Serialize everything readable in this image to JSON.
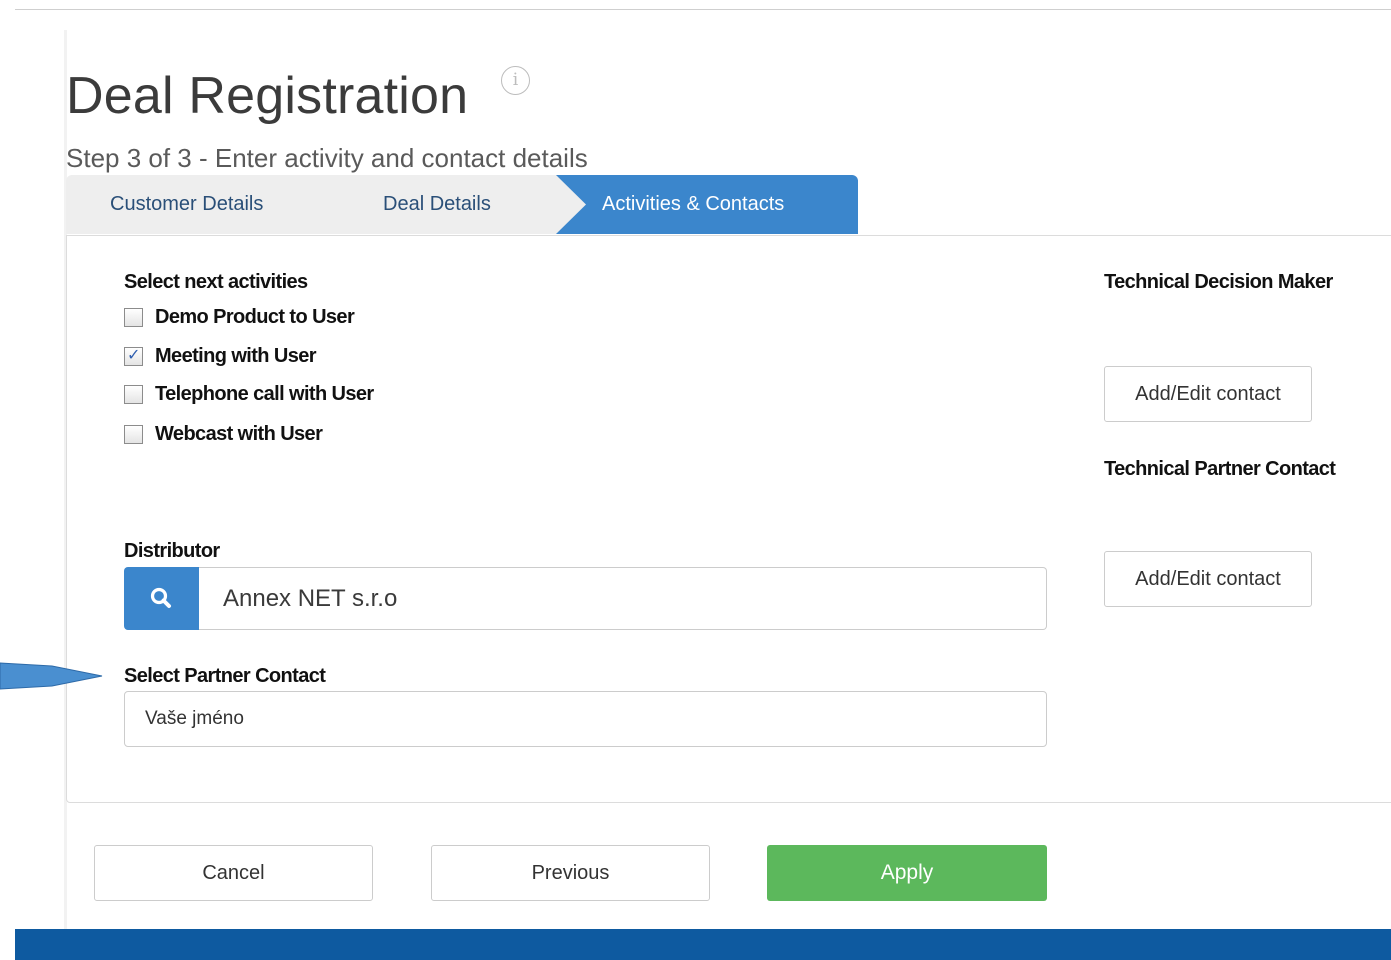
{
  "page": {
    "title": "Deal Registration",
    "info_icon_glyph": "i",
    "step_text": "Step 3 of 3 - Enter activity and contact details"
  },
  "wizard": {
    "tabs": [
      {
        "label": "Customer Details",
        "state": "done"
      },
      {
        "label": "Deal Details",
        "state": "done"
      },
      {
        "label": "Activities & Contacts",
        "state": "active"
      }
    ],
    "active_color": "#3b86cc",
    "inactive_color": "#eeeeee"
  },
  "activities": {
    "heading": "Select next activities",
    "items": [
      {
        "label": "Demo Product to User",
        "checked": false
      },
      {
        "label": "Meeting with User",
        "checked": true
      },
      {
        "label": "Telephone call with User",
        "checked": false
      },
      {
        "label": "Webcast with User",
        "checked": false
      }
    ]
  },
  "distributor": {
    "label": "Distributor",
    "value": "Annex NET s.r.o",
    "search_icon": "search-icon"
  },
  "partner_contact": {
    "label": "Select Partner Contact",
    "placeholder": "Vaše jméno"
  },
  "technical_decision_maker": {
    "label": "Technical Decision Maker",
    "button": "Add/Edit contact"
  },
  "technical_partner_contact": {
    "label": "Technical Partner Contact",
    "button": "Add/Edit contact"
  },
  "actions": {
    "cancel": "Cancel",
    "previous": "Previous",
    "apply": "Apply",
    "apply_color": "#5cb85c"
  },
  "footer": {
    "color": "#0e5aa0"
  }
}
